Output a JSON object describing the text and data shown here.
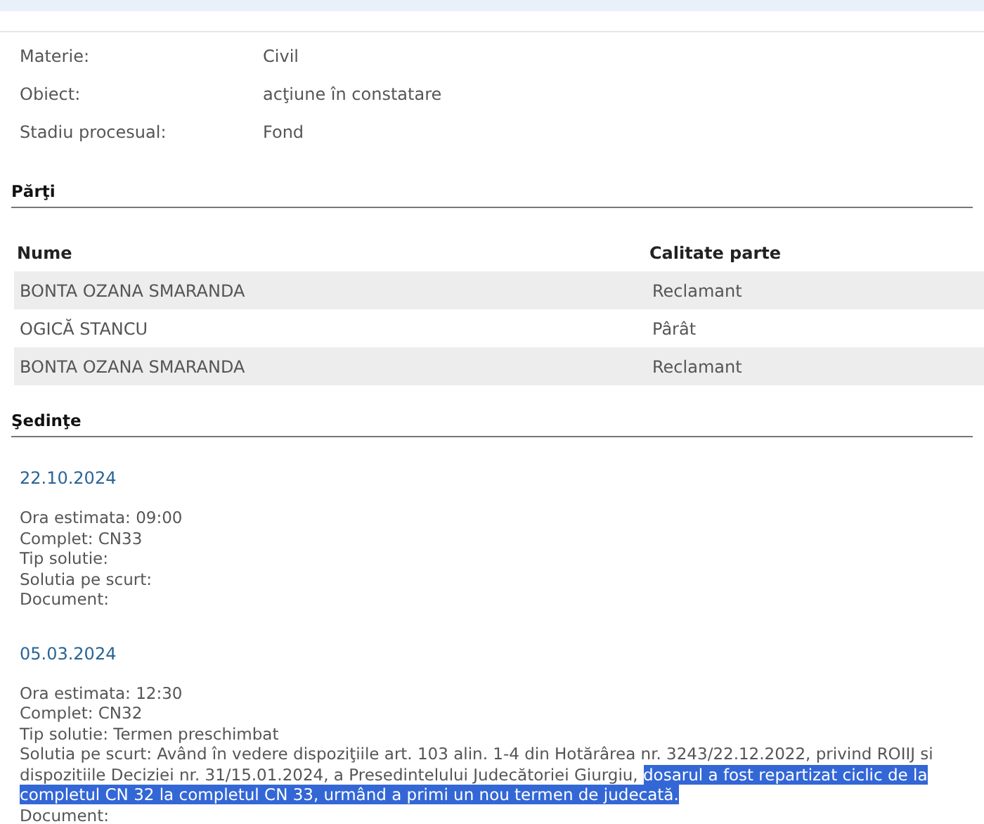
{
  "details": [
    {
      "label": "Materie:",
      "value": "Civil"
    },
    {
      "label": "Obiect:",
      "value": "acţiune în constatare"
    },
    {
      "label": "Stadiu procesual:",
      "value": "Fond"
    }
  ],
  "parties": {
    "title": "Părţi",
    "columns": [
      "Nume",
      "Calitate parte"
    ],
    "rows": [
      [
        "BONTA OZANA SMARANDA",
        "Reclamant"
      ],
      [
        "OGICĂ STANCU",
        "Pârât"
      ],
      [
        "BONTA OZANA SMARANDA",
        "Reclamant"
      ]
    ]
  },
  "hearings": {
    "title": "Şedinţe",
    "items": [
      {
        "date": "22.10.2024",
        "lines": [
          [
            {
              "text": "Ora estimata: 09:00",
              "highlighted": false
            }
          ],
          [
            {
              "text": "Complet: CN33",
              "highlighted": false
            }
          ],
          [
            {
              "text": "Tip solutie:",
              "highlighted": false
            }
          ],
          [
            {
              "text": "Solutia pe scurt:",
              "highlighted": false
            }
          ],
          [
            {
              "text": "Document:",
              "highlighted": false
            }
          ]
        ]
      },
      {
        "date": "05.03.2024",
        "lines": [
          [
            {
              "text": "Ora estimata: 12:30",
              "highlighted": false
            }
          ],
          [
            {
              "text": "Complet: CN32",
              "highlighted": false
            }
          ],
          [
            {
              "text": "Tip solutie: Termen preschimbat",
              "highlighted": false
            }
          ],
          [
            {
              "text": "Solutia pe scurt: Având în vedere dispoziţiile art. 103 alin. 1-4 din Hotărârea nr. 3243/22.12.2022, privind ROIIJ si dispozitiile Deciziei nr. 31/15.01.2024, a Presedintelului Judecătoriei Giurgiu, ",
              "highlighted": false
            },
            {
              "text": "dosarul a fost repartizat ciclic de la completul CN 32 la completul CN 33, urmând a primi un nou termen de judecată.",
              "highlighted": true
            }
          ],
          [
            {
              "text": "Document:",
              "highlighted": false
            }
          ]
        ]
      }
    ]
  }
}
